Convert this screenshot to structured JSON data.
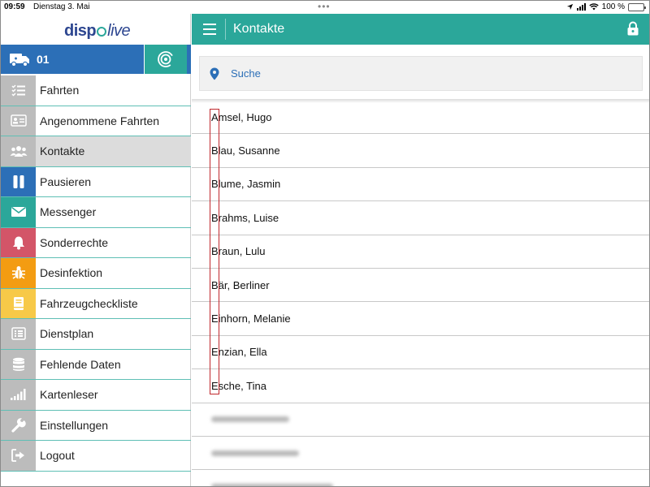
{
  "status_bar": {
    "time": "09:59",
    "date": "Dienstag 3. Mai",
    "battery": "100 %",
    "battery_level": 1.0
  },
  "logo": {
    "part1": "disp",
    "part2": "live"
  },
  "vehicle": {
    "number": "01"
  },
  "menu": [
    {
      "label": "Fahrten",
      "icon": "list-icon",
      "color": "#bcbcbc"
    },
    {
      "label": "Angenommene Fahrten",
      "icon": "id-card-icon",
      "color": "#bcbcbc"
    },
    {
      "label": "Kontakte",
      "icon": "users-icon",
      "color": "#bcbcbc",
      "active": true
    },
    {
      "label": "Pausieren",
      "icon": "pause-icon",
      "color": "#2c6fb7"
    },
    {
      "label": "Messenger",
      "icon": "envelope-icon",
      "color": "#2ba79a"
    },
    {
      "label": "Sonderrechte",
      "icon": "bell-icon",
      "color": "#d35568"
    },
    {
      "label": "Desinfektion",
      "icon": "bug-icon",
      "color": "#f39c12"
    },
    {
      "label": "Fahrzeugcheckliste",
      "icon": "book-icon",
      "color": "#f7c948"
    },
    {
      "label": "Dienstplan",
      "icon": "schedule-icon",
      "color": "#bcbcbc"
    },
    {
      "label": "Fehlende Daten",
      "icon": "database-icon",
      "color": "#bcbcbc"
    },
    {
      "label": "Kartenleser",
      "icon": "signal-bars-icon",
      "color": "#bcbcbc"
    },
    {
      "label": "Einstellungen",
      "icon": "wrench-icon",
      "color": "#bcbcbc"
    },
    {
      "label": "Logout",
      "icon": "logout-icon",
      "color": "#bcbcbc"
    }
  ],
  "header": {
    "title": "Kontakte"
  },
  "search": {
    "placeholder": "Suche"
  },
  "contacts": [
    "Amsel, Hugo",
    "Blau, Susanne",
    "Blume, Jasmin",
    "Brahms, Luise",
    "Braun, Lulu",
    "Bär, Berliner",
    "Einhorn, Melanie",
    "Enzian, Ella",
    "Esche, Tina"
  ],
  "colors": {
    "accent": "#2ba79a",
    "primary_blue": "#2c6fb7",
    "highlight_box": "#c0282d"
  }
}
